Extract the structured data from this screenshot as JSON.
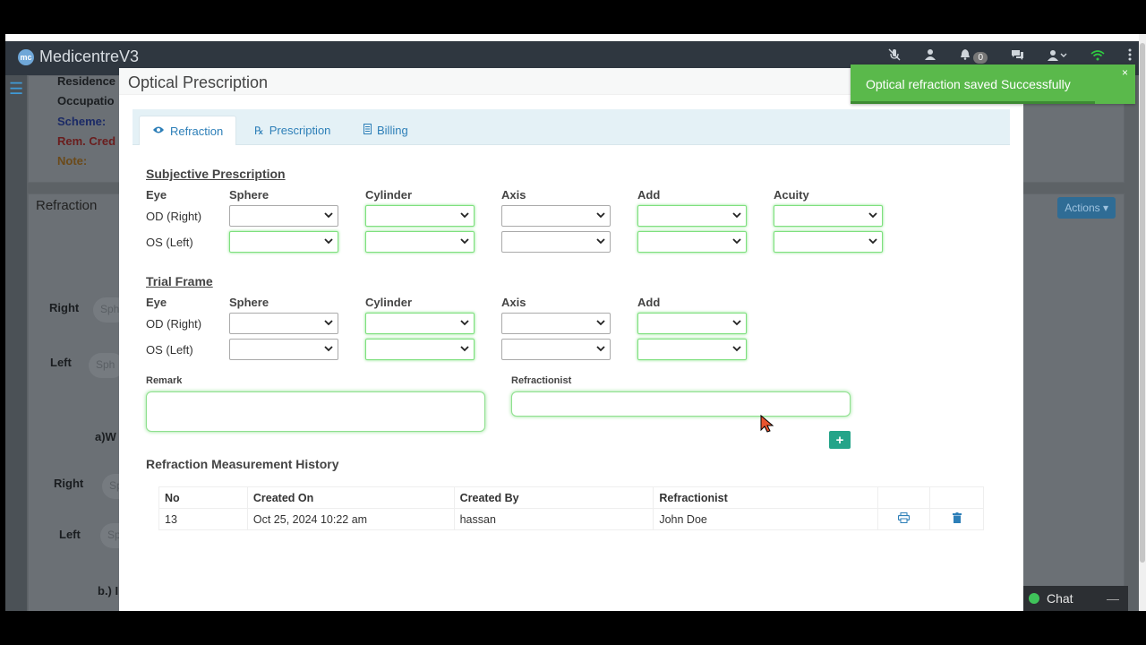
{
  "app": {
    "brand": "MedicentreV3",
    "brand_logo_text": "mc",
    "notifications_count": "0"
  },
  "background": {
    "labels": {
      "residence": "Residence",
      "occupation": "Occupatio",
      "scheme": "Scheme:",
      "rem_credit": "Rem. Cred",
      "note": "Note:",
      "refraction_panel": "Refraction",
      "right1": "Right",
      "left1": "Left",
      "sph1": "Sph",
      "sph2": "Sph",
      "a_w": "a)W",
      "right2": "Right",
      "left2": "Left",
      "sp3": "Sp",
      "sp4": "Sp",
      "b": "b.) I"
    },
    "actions_label": "Actions ▾"
  },
  "modal": {
    "title": "Optical Prescription",
    "tabs": [
      {
        "label": "Refraction",
        "icon": "eye-icon",
        "active": true
      },
      {
        "label": "Prescription",
        "icon": "rx-icon",
        "active": false
      },
      {
        "label": "Billing",
        "icon": "document-icon",
        "active": false
      }
    ],
    "subjective": {
      "title": "Subjective Prescription",
      "columns": [
        "Eye",
        "Sphere",
        "Cylinder",
        "Axis",
        "Add",
        "Acuity"
      ],
      "rows": [
        "OD (Right)",
        "OS (Left)"
      ]
    },
    "trial_frame": {
      "title": "Trial Frame",
      "columns": [
        "Eye",
        "Sphere",
        "Cylinder",
        "Axis",
        "Add"
      ],
      "rows": [
        "OD (Right)",
        "OS (Left)"
      ]
    },
    "remark_label": "Remark",
    "refractionist_label": "Refractionist",
    "remark_value": "",
    "refractionist_value": "",
    "add_button": "+",
    "history": {
      "title": "Refraction Measurement History",
      "headers": [
        "No",
        "Created On",
        "Created By",
        "Refractionist",
        "",
        ""
      ],
      "rows": [
        {
          "no": "13",
          "created_on": "Oct 25, 2024 10:22 am",
          "created_by": "hassan",
          "refractionist": "John Doe"
        }
      ]
    }
  },
  "toast": {
    "message": "Optical refraction saved Successfully",
    "close": "×",
    "progress": 0.86,
    "color": "#5ab94b"
  },
  "chat": {
    "label": "Chat",
    "minimize": "—"
  }
}
